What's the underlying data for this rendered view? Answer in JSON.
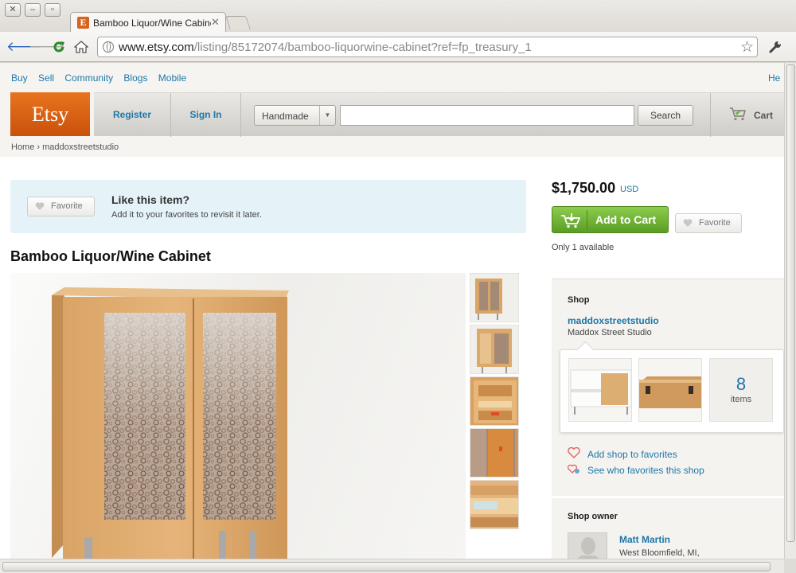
{
  "browser": {
    "tab_title": "Bamboo Liquor/Wine Cabinet",
    "url_domain": "www.etsy.com",
    "url_path": "/listing/85172074/bamboo-liquorwine-cabinet?ref=fp_treasury_1",
    "favicon_letter": "E",
    "icons": [
      "back-icon",
      "forward-icon",
      "reload-icon",
      "home-icon",
      "globe-icon",
      "star-icon",
      "wrench-icon"
    ]
  },
  "topnav": {
    "buy": "Buy",
    "sell": "Sell",
    "community": "Community",
    "blogs": "Blogs",
    "mobile": "Mobile",
    "help": "He"
  },
  "header": {
    "logo": "Etsy",
    "register": "Register",
    "sign_in": "Sign In",
    "category": "Handmade",
    "search_value": "",
    "search_button": "Search",
    "cart": "Cart"
  },
  "breadcrumb": {
    "home": "Home",
    "separator": "›",
    "shop": "maddoxstreetstudio"
  },
  "favorite_banner": {
    "button": "Favorite",
    "title": "Like this item?",
    "subtitle": "Add it to your favorites to revisit it later."
  },
  "listing": {
    "title": "Bamboo Liquor/Wine Cabinet",
    "price": "$1,750.00",
    "currency": "USD",
    "add_to_cart": "Add to Cart",
    "favorite": "Favorite",
    "availability": "Only 1 available"
  },
  "shop": {
    "heading": "Shop",
    "name": "maddoxstreetstudio",
    "full_name": "Maddox Street Studio",
    "items_count": "8",
    "items_label": "items",
    "add_favorites": "Add shop to favorites",
    "see_favorites": "See who favorites this shop"
  },
  "owner": {
    "heading": "Shop owner",
    "name": "Matt Martin",
    "location": "West Bloomfield, MI,"
  },
  "colors": {
    "etsy_orange": "#d5641c",
    "link_blue": "#1f77a8",
    "cart_green": "#6fb136",
    "banner_blue": "#e5f3f8"
  }
}
